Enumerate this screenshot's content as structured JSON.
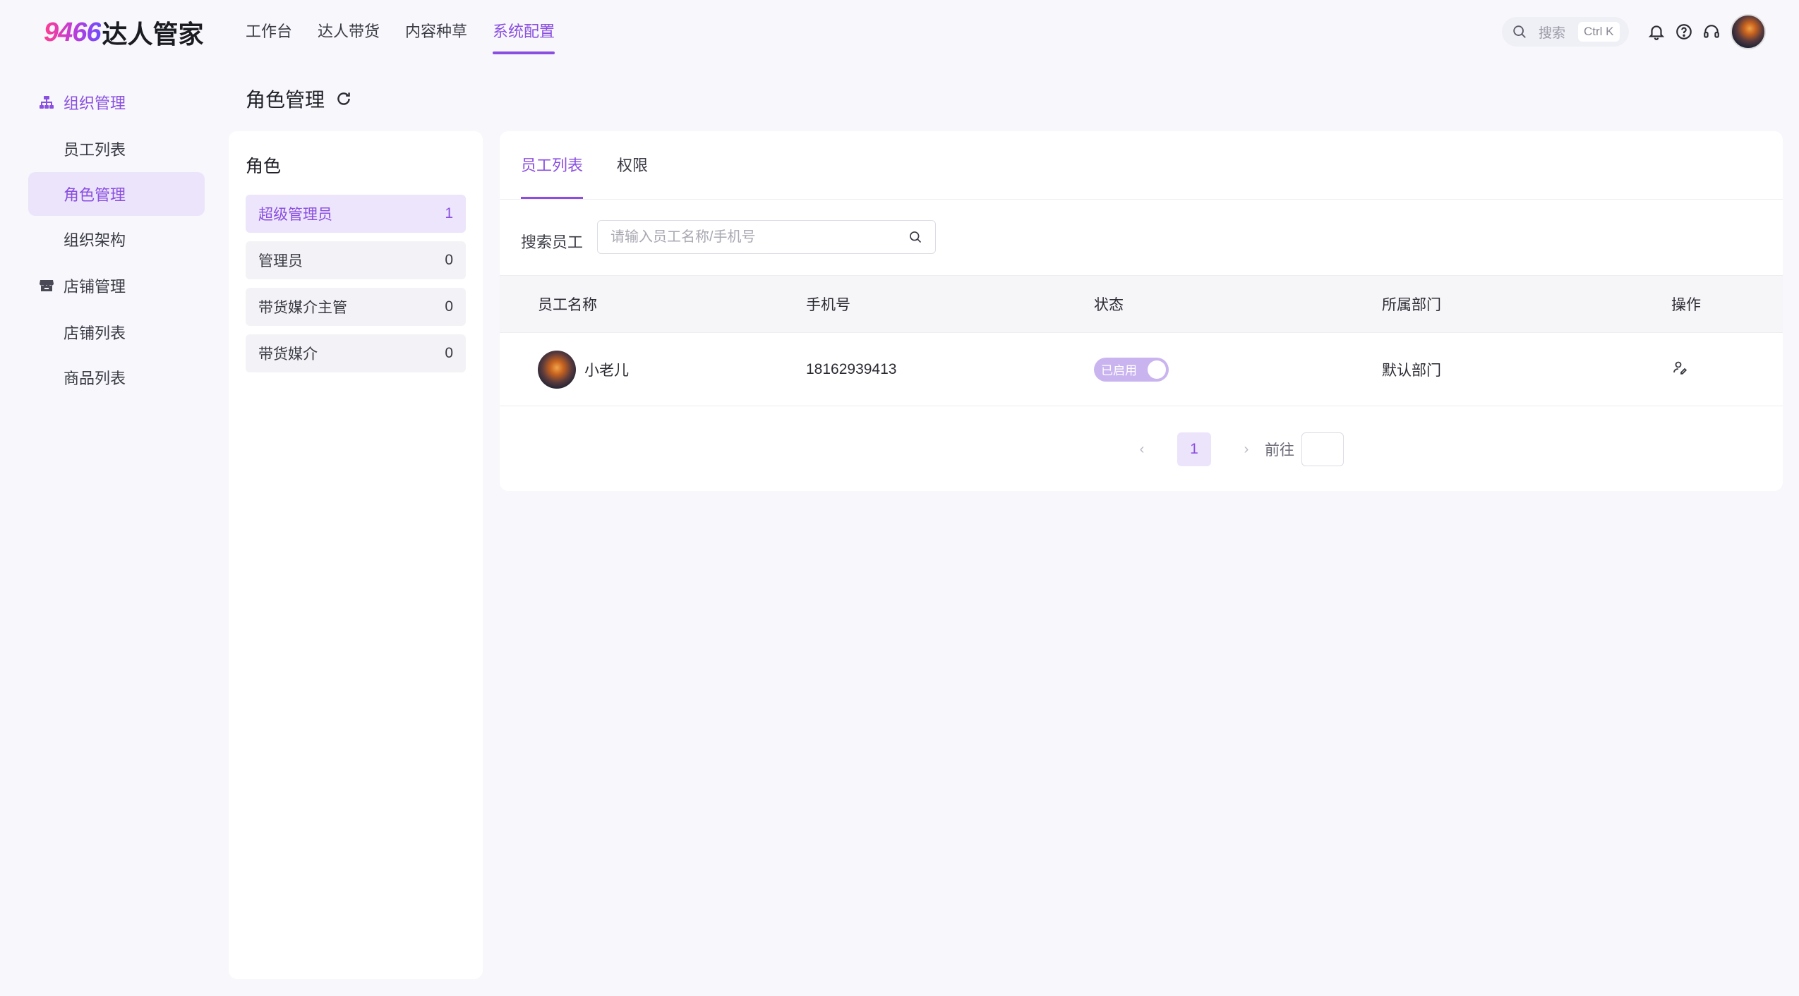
{
  "header": {
    "logo_number": "9466",
    "logo_text": "达人管家",
    "nav": [
      {
        "label": "工作台"
      },
      {
        "label": "达人带货"
      },
      {
        "label": "内容种草"
      },
      {
        "label": "系统配置"
      }
    ],
    "active_nav": "系统配置",
    "search_label": "搜索",
    "shortcut": "Ctrl K"
  },
  "sidebar": {
    "groups": [
      {
        "label": "组织管理",
        "icon": "org-chart-icon",
        "items": [
          "员工列表",
          "角色管理",
          "组织架构"
        ]
      },
      {
        "label": "店铺管理",
        "icon": "store-icon",
        "items": [
          "店铺列表",
          "商品列表"
        ]
      }
    ],
    "active_item": "角色管理"
  },
  "page": {
    "title": "角色管理"
  },
  "roles": {
    "title": "角色",
    "items": [
      {
        "name": "超级管理员",
        "count": "1"
      },
      {
        "name": "管理员",
        "count": "0"
      },
      {
        "name": "带货媒介主管",
        "count": "0"
      },
      {
        "name": "带货媒介",
        "count": "0"
      }
    ],
    "active": "超级管理员"
  },
  "main": {
    "tabs": [
      {
        "label": "员工列表"
      },
      {
        "label": "权限"
      }
    ],
    "active_tab": "员工列表",
    "search": {
      "label": "搜索员工",
      "placeholder": "请输入员工名称/手机号"
    },
    "table": {
      "headers": [
        "员工名称",
        "手机号",
        "状态",
        "所属部门",
        "操作"
      ],
      "rows": [
        {
          "name": "小老儿",
          "phone": "18162939413",
          "status": "已启用",
          "department": "默认部门"
        }
      ]
    },
    "pagination": {
      "current": "1",
      "goto_label": "前往"
    }
  },
  "colors": {
    "accent": "#8a4fe0",
    "accent_light": "#ece4fb",
    "background": "#f7f7fc"
  }
}
